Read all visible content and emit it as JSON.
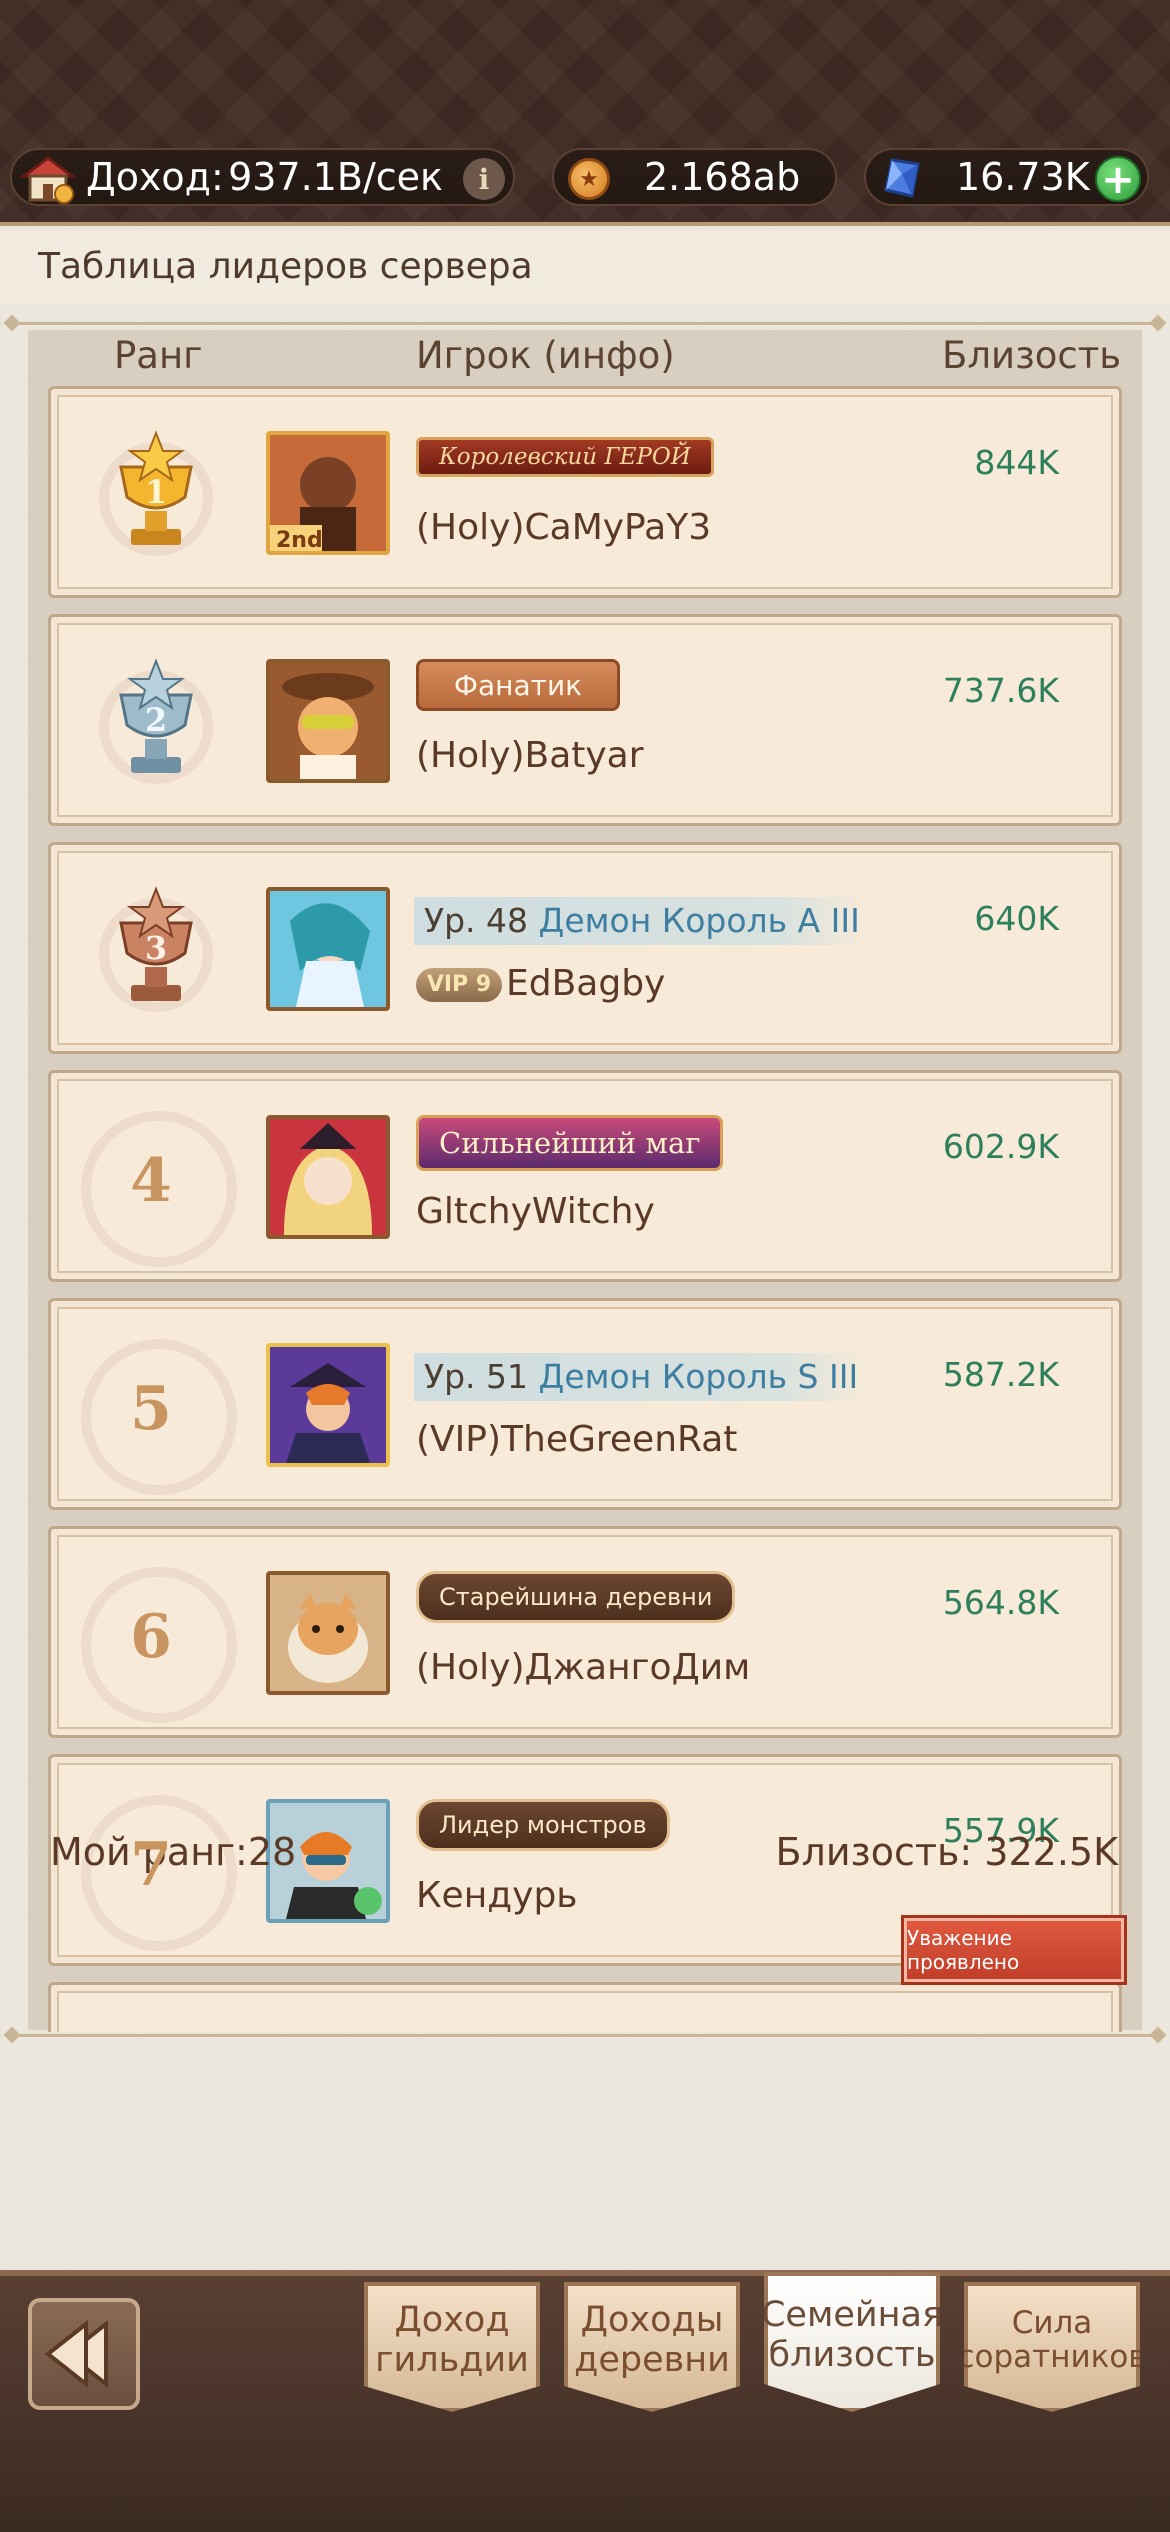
{
  "resources": {
    "income_label": "Доход:",
    "income_value": "937.1B/сек",
    "coins_value": "2.168ab",
    "gems_value": "16.73K"
  },
  "panel": {
    "title": "Таблица лидеров сервера",
    "col_rank": "Ранг",
    "col_player": "Игрок (инфо)",
    "col_affinity": "Близость"
  },
  "rows": [
    {
      "rank": "1",
      "title": "Королевский ГЕРОЙ",
      "name": "(Holy)CaMyPaY3",
      "affinity": "844K"
    },
    {
      "rank": "2",
      "title": "Фанатик",
      "name": "(Holy)Batyar",
      "affinity": "737.6K"
    },
    {
      "rank": "3",
      "level": "Ур. 48",
      "class": "Демон Король A III",
      "vip": "VIP 9",
      "name": "EdBagby",
      "affinity": "640K"
    },
    {
      "rank": "4",
      "title": "Сильнейший маг",
      "name": "GltchyWitchy",
      "affinity": "602.9K"
    },
    {
      "rank": "5",
      "level": "Ур. 51",
      "class": "Демон Король S III",
      "name": "(VIP)TheGreenRat",
      "affinity": "587.2K"
    },
    {
      "rank": "6",
      "title": "Старейшина деревни",
      "name": "(Holy)ДжангоДим",
      "affinity": "564.8K"
    },
    {
      "rank": "7",
      "title": "Лидер монстров",
      "name": "Кендурь",
      "affinity": "557.9K"
    }
  ],
  "footer": {
    "my_rank": "Мой ранг:28",
    "my_affinity": "Близость:  322.5K",
    "respect_button": "Уважение проявлено"
  },
  "tabs": {
    "guild_income": "Доход гильдии",
    "village_income": "Доходы деревни",
    "family_affinity": "Семейная близость",
    "ally_power": "Сила соратников"
  }
}
